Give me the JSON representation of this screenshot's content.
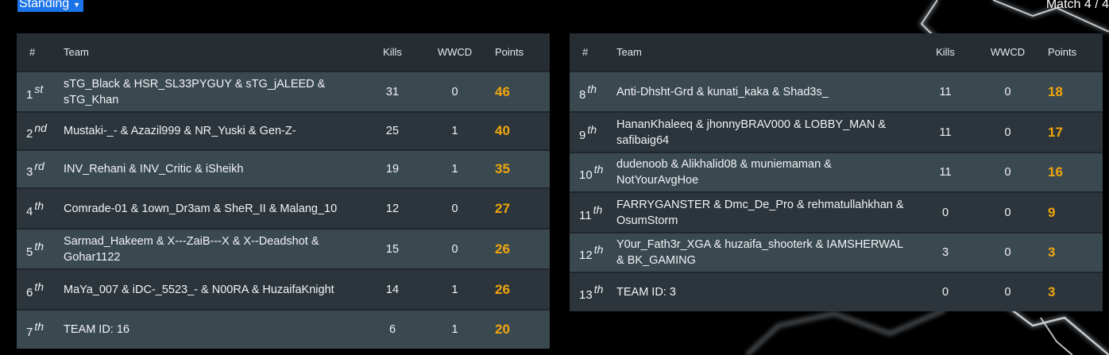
{
  "header": {
    "standing_label": "Standing",
    "match_label": "Match 4 / 4"
  },
  "columns": {
    "rank": "#",
    "team": "Team",
    "kills": "Kills",
    "wwcd": "WWCD",
    "points": "Points"
  },
  "colors": {
    "points": "#f0a60c",
    "select_bg": "#1a73e8",
    "row_odd": "#3a4850",
    "row_even": "#2c353b"
  },
  "left_table": [
    {
      "rank": "1",
      "suffix": "st",
      "team": "sTG_Black & HSR_SL33PYGUY & sTG_jALEED & sTG_Khan",
      "kills": "31",
      "wwcd": "0",
      "points": "46"
    },
    {
      "rank": "2",
      "suffix": "nd",
      "team": "Mustaki-_- & Azazil999 & NR_Yuski & Gen-Z-",
      "kills": "25",
      "wwcd": "1",
      "points": "40"
    },
    {
      "rank": "3",
      "suffix": "rd",
      "team": "INV_Rehani & INV_Critic & iSheikh",
      "kills": "19",
      "wwcd": "1",
      "points": "35"
    },
    {
      "rank": "4",
      "suffix": "th",
      "team": "Comrade-01 & 1own_Dr3am & SheR_II & Malang_10",
      "kills": "12",
      "wwcd": "0",
      "points": "27"
    },
    {
      "rank": "5",
      "suffix": "th",
      "team": "Sarmad_Hakeem & X---ZaiB---X & X--Deadshot & Gohar1122",
      "kills": "15",
      "wwcd": "0",
      "points": "26"
    },
    {
      "rank": "6",
      "suffix": "th",
      "team": "MaYa_007 & iDC-_5523_- & N00RA & HuzaifaKnight",
      "kills": "14",
      "wwcd": "1",
      "points": "26"
    },
    {
      "rank": "7",
      "suffix": "th",
      "team": "TEAM ID: 16",
      "kills": "6",
      "wwcd": "1",
      "points": "20"
    }
  ],
  "right_table": [
    {
      "rank": "8",
      "suffix": "th",
      "team": "Anti-Dhsht-Grd & kunati_kaka & Shad3s_",
      "kills": "11",
      "wwcd": "0",
      "points": "18"
    },
    {
      "rank": "9",
      "suffix": "th",
      "team": "HananKhaleeq & jhonnyBRAV000 & LOBBY_MAN & safibaig64",
      "kills": "11",
      "wwcd": "0",
      "points": "17"
    },
    {
      "rank": "10",
      "suffix": "th",
      "team": "dudenoob & Alikhalid08 & muniemaman & NotYourAvgHoe",
      "kills": "11",
      "wwcd": "0",
      "points": "16"
    },
    {
      "rank": "11",
      "suffix": "th",
      "team": "FARRYGANSTER & Dmc_De_Pro & rehmatullahkhan & OsumStorm",
      "kills": "0",
      "wwcd": "0",
      "points": "9"
    },
    {
      "rank": "12",
      "suffix": "th",
      "team": "Y0ur_Fath3r_XGA & huzaifa_shooterk & IAMSHERWAL & BK_GAMING",
      "kills": "3",
      "wwcd": "0",
      "points": "3"
    },
    {
      "rank": "13",
      "suffix": "th",
      "team": "TEAM ID: 3",
      "kills": "0",
      "wwcd": "0",
      "points": "3"
    }
  ]
}
